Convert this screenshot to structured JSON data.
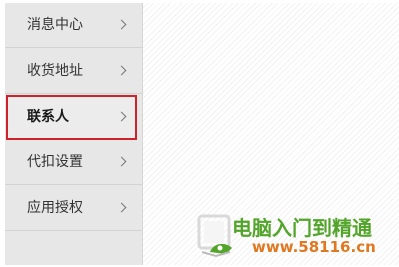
{
  "sidebar": {
    "items": [
      {
        "label": "消息中心",
        "active": false
      },
      {
        "label": "收货地址",
        "active": false
      },
      {
        "label": "联系人",
        "active": true
      },
      {
        "label": "代扣设置",
        "active": false
      },
      {
        "label": "应用授权",
        "active": false
      }
    ]
  },
  "watermark": {
    "title": "电脑入门到精通",
    "url": "www.58116.cn"
  },
  "colors": {
    "active_border": "#d0202a",
    "sidebar_bg": "#e7e7e7",
    "watermark_green": "#52a52a",
    "watermark_orange": "#e07820"
  }
}
